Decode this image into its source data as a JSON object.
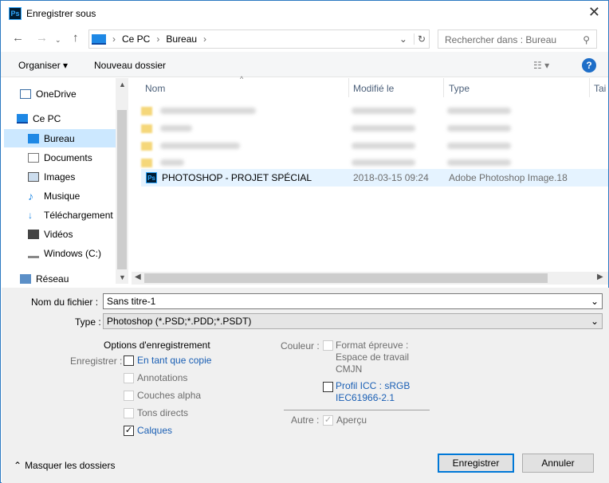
{
  "window": {
    "title": "Enregistrer sous",
    "app_icon": "Ps"
  },
  "address": {
    "crumbs": [
      "Ce PC",
      "Bureau"
    ],
    "search_placeholder": "Rechercher dans : Bureau"
  },
  "toolbar": {
    "organize": "Organiser ▾",
    "new_folder": "Nouveau dossier",
    "help": "?"
  },
  "sidebar": {
    "items": [
      {
        "label": "OneDrive"
      },
      {
        "label": "Ce PC"
      },
      {
        "label": "Bureau"
      },
      {
        "label": "Documents"
      },
      {
        "label": "Images"
      },
      {
        "label": "Musique"
      },
      {
        "label": "Téléchargement"
      },
      {
        "label": "Vidéos"
      },
      {
        "label": "Windows (C:)"
      },
      {
        "label": "Réseau"
      }
    ]
  },
  "files": {
    "columns": [
      "Nom",
      "Modifié le",
      "Type",
      "Tai"
    ],
    "selected": {
      "name": "PHOTOSHOP - PROJET SPÉCIAL",
      "modified": "2018-03-15 09:24",
      "type": "Adobe Photoshop Image.18"
    }
  },
  "form": {
    "filename_label": "Nom du fichier :",
    "filename_value": "Sans titre-1",
    "type_label": "Type :",
    "type_value": "Photoshop (*.PSD;*.PDD;*.PSDT)"
  },
  "options": {
    "heading": "Options d'enregistrement",
    "save_label": "Enregistrer :",
    "as_copy": "En tant que copie",
    "annotations": "Annotations",
    "alpha": "Couches alpha",
    "spot": "Tons directs",
    "layers": "Calques",
    "color_label": "Couleur :",
    "proof_lines": [
      "Format épreuve :",
      "Espace de travail",
      "CMJN"
    ],
    "icc_lines": [
      "Profil ICC : sRGB",
      "IEC61966-2.1"
    ],
    "other_label": "Autre :",
    "preview": "Aperçu"
  },
  "footer": {
    "hide_folders": "Masquer les dossiers",
    "save": "Enregistrer",
    "cancel": "Annuler"
  }
}
